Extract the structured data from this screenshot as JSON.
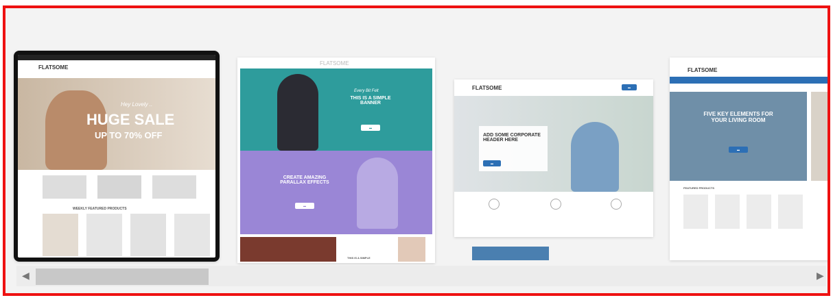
{
  "slides": [
    {
      "logo": "FLATSOME",
      "kicker": "Hey Lovely ..",
      "headline": "HUGE SALE",
      "subline": "UP TO 70% OFF",
      "section": "WEEKLY FEATURED PRODUCTS"
    },
    {
      "logo": "FLATSOME",
      "banner_kicker": "Every Bit Felt",
      "banner_title": "THIS IS A SIMPLE BANNER",
      "parallax_title": "CREATE AMAZING PARALLAX EFFECTS",
      "bottom_text": "THIS IS A SIMPLE"
    },
    {
      "logo": "FLATSOME",
      "header_title": "ADD SOME CORPORATE HEADER HERE"
    },
    {
      "logo": "FLATSOME",
      "hero_title": "FIVE KEY ELEMENTS FOR YOUR LIVING ROOM",
      "section": "FEATURED PRODUCTS"
    }
  ],
  "scrollbar": {
    "left_arrow": "◀",
    "right_arrow": "▶"
  },
  "colors": {
    "frame": "#e11111",
    "teal": "#2e9c9c",
    "purple": "#9a86d6",
    "blue": "#2c6fb5"
  }
}
